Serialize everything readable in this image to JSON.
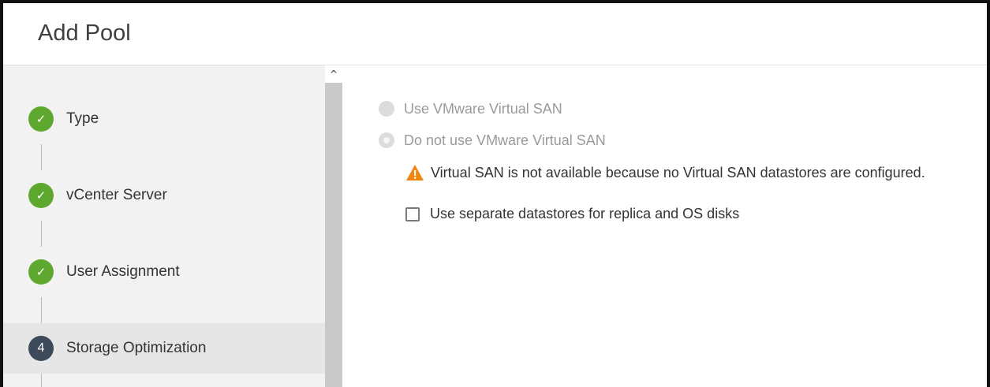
{
  "dialog": {
    "title": "Add Pool"
  },
  "steps": [
    {
      "label": "Type",
      "status": "done",
      "icon": "check-icon"
    },
    {
      "label": "vCenter Server",
      "status": "done",
      "icon": "check-icon"
    },
    {
      "label": "User Assignment",
      "status": "done",
      "icon": "check-icon"
    },
    {
      "label": "Storage Optimization",
      "status": "current",
      "number": "4"
    }
  ],
  "scrollbar": {
    "up_glyph": "^"
  },
  "storage": {
    "option_vsan": "Use VMware Virtual SAN",
    "option_no_vsan": "Do not use VMware Virtual SAN",
    "warning": "Virtual SAN is not available because no Virtual SAN datastores are configured.",
    "separate_datastores_label": "Use separate datastores for replica and OS disks",
    "separate_datastores_checked": false
  },
  "colors": {
    "done_step": "#5ea82f",
    "current_step": "#3c4a5a",
    "warning": "#f0860e"
  }
}
